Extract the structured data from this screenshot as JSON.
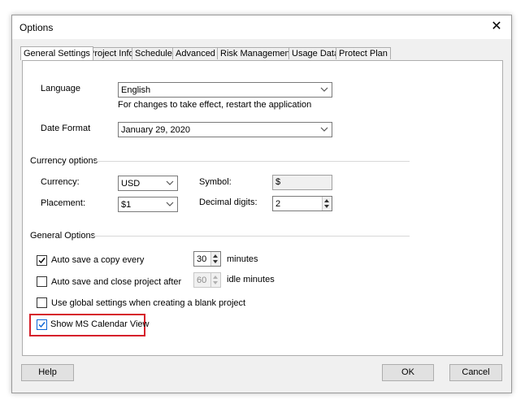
{
  "window": {
    "title": "Options",
    "close_glyph": "✕"
  },
  "tabs": [
    {
      "label": "General Settings",
      "active": true
    },
    {
      "label": "Project Info"
    },
    {
      "label": "Schedule"
    },
    {
      "label": "Advanced"
    },
    {
      "label": "Risk Management"
    },
    {
      "label": "Usage Data"
    },
    {
      "label": "Protect Plan"
    }
  ],
  "language": {
    "label": "Language",
    "value": "English",
    "hint": "For changes to take effect, restart the application"
  },
  "date_format": {
    "label": "Date Format",
    "value": "January 29, 2020"
  },
  "currency_options": {
    "header": "Currency options",
    "currency_label": "Currency:",
    "currency_value": "USD",
    "symbol_label": "Symbol:",
    "symbol_value": "$",
    "placement_label": "Placement:",
    "placement_value": "$1",
    "decimal_label": "Decimal digits:",
    "decimal_value": "2"
  },
  "general_options": {
    "header": "General Options",
    "auto_save": {
      "label": "Auto save a copy every",
      "checked": true,
      "value": "30",
      "unit": "minutes"
    },
    "auto_close": {
      "label": "Auto save and close project after",
      "checked": false,
      "value": "60",
      "unit": "idle minutes"
    },
    "global_settings": {
      "label": "Use global settings when creating a blank project",
      "checked": false
    },
    "ms_calendar": {
      "label": "Show MS Calendar View",
      "checked": true
    }
  },
  "buttons": {
    "help": "Help",
    "ok": "OK",
    "cancel": "Cancel"
  },
  "colors": {
    "highlight": "#d6212b",
    "checkbox_accent": "#0a64d6"
  }
}
